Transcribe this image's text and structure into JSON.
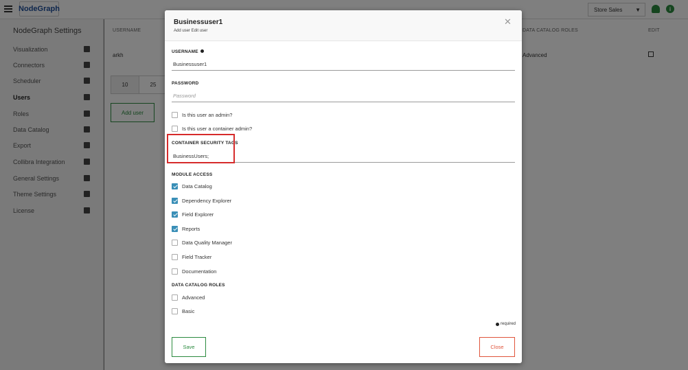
{
  "topbar": {
    "logo": "NodeGraph",
    "store_select": "Store Sales",
    "info_icon_text": "i"
  },
  "sidebar": {
    "title": "NodeGraph Settings",
    "items": [
      {
        "label": "Visualization",
        "icon": "folder-icon"
      },
      {
        "label": "Connectors",
        "icon": "connector-icon"
      },
      {
        "label": "Scheduler",
        "icon": "wrench-icon"
      },
      {
        "label": "Users",
        "icon": "users-icon",
        "active": true
      },
      {
        "label": "Roles",
        "icon": "shield-icon"
      },
      {
        "label": "Data Catalog",
        "icon": "monitor-icon"
      },
      {
        "label": "Export",
        "icon": "cloud-upload-icon"
      },
      {
        "label": "Collibra Integration",
        "icon": "sync-icon"
      },
      {
        "label": "General Settings",
        "icon": "gear-icon"
      },
      {
        "label": "Theme Settings",
        "icon": "palette-icon"
      },
      {
        "label": "License",
        "icon": "file-icon"
      }
    ]
  },
  "main": {
    "col_username": "USERNAME",
    "col_roles": "DATA CATALOG ROLES",
    "col_edit": "EDIT",
    "row_username": "arkh",
    "row_roles": "Advanced",
    "pager": [
      "10",
      "25"
    ],
    "add_user": "Add user"
  },
  "modal": {
    "title": "Businessuser1",
    "subtitle": "Add user Edit user",
    "username_label": "USERNAME",
    "username_value": "Businessuser1",
    "password_label": "PASSWORD",
    "password_placeholder": "Password",
    "is_admin": "Is this user an admin?",
    "is_container_admin": "Is this user a container admin?",
    "tags_label": "CONTAINER SECURITY TAGS",
    "tags_value": "BusinessUsers;",
    "module_label": "MODULE ACCESS",
    "modules": [
      {
        "label": "Data Catalog",
        "checked": true
      },
      {
        "label": "Dependency Explorer",
        "checked": true
      },
      {
        "label": "Field Explorer",
        "checked": true
      },
      {
        "label": "Reports",
        "checked": true
      },
      {
        "label": "Data Quality Manager",
        "checked": false
      },
      {
        "label": "Field Tracker",
        "checked": false
      },
      {
        "label": "Documentation",
        "checked": false
      }
    ],
    "roles_label": "DATA CATALOG ROLES",
    "roles": [
      {
        "label": "Advanced",
        "checked": false
      },
      {
        "label": "Basic",
        "checked": false
      }
    ],
    "required_note": "required",
    "save": "Save",
    "close": "Close"
  },
  "colors": {
    "accent_green": "#2a8a3e",
    "checkbox_blue": "#3a8fb7",
    "close_orange": "#e0533a",
    "highlight_red": "#d62a2a"
  }
}
